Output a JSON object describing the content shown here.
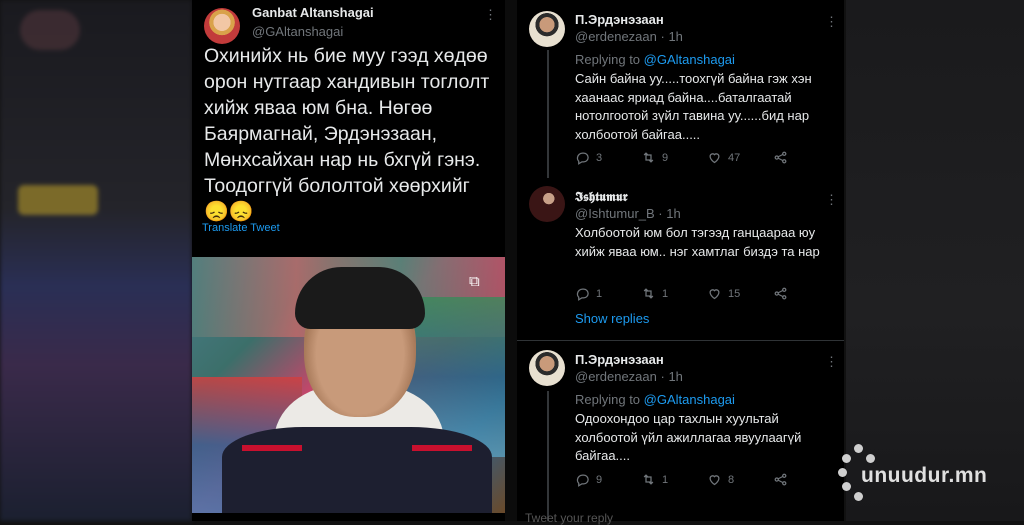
{
  "main_tweet": {
    "author_name": "Ganbat Altanshagai",
    "author_handle": "@GAltanshagai",
    "text": "Охинийх нь бие муу гээд хөдөө орон нутгаар хандивын тоглолт хийж яваа юм бна. Нөгөө Баярмагнай, Эрдэнэзаан, Мөнхсайхан нар нь бхгүй гэнэ. Тоодоггүй бололтой хөөрхийг",
    "emoji": "😞😞",
    "translate_label": "Translate Tweet"
  },
  "replies": [
    {
      "author_name": "П.Эрдэнэзаан",
      "author_handle": "@erdenezaan",
      "time": "1h",
      "replying_prefix": "Replying to",
      "replying_to": "@GAltanshagai",
      "text": "Сайн байна уу.....тоохгүй байна гэж хэн хаанаас яриад байна....баталгаатай нотолгоотой зүйл тавина уу......бид нар холбоотой байгаа.....",
      "replies": "3",
      "retweets": "9",
      "likes": "47"
    },
    {
      "author_name": "𝕴𝖘𝖍𝖙𝖚𝖒𝖚𝖗",
      "author_handle": "@Ishtumur_B",
      "time": "1h",
      "text": "Холбоотой юм бол тэгээд ганцаараа юу хийж яваа юм.. нэг хамтлаг биздэ та нар",
      "replies": "1",
      "retweets": "1",
      "likes": "15",
      "show_replies": "Show replies"
    },
    {
      "author_name": "П.Эрдэнэзаан",
      "author_handle": "@erdenezaan",
      "time": "1h",
      "replying_prefix": "Replying to",
      "replying_to": "@GAltanshagai",
      "text": "Одоохондоо цар тахлын хуультай холбоотой үйл ажиллагаа явуулаагүй байгаа....",
      "replies": "9",
      "retweets": "1",
      "likes": "8"
    }
  ],
  "bottom_peek": "Tweet your reply",
  "watermark": "unuudur.mn",
  "colors": {
    "link": "#1d9bf0",
    "secondary": "#71767b",
    "background": "#000000"
  }
}
